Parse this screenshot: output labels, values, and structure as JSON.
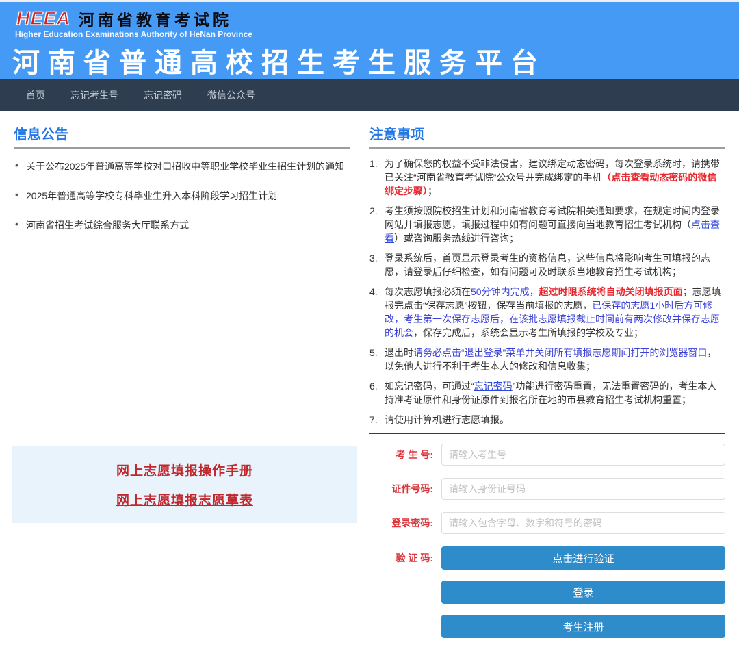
{
  "header": {
    "logo_acronym": "HEEA",
    "org_name_cn": "河南省教育考试院",
    "org_name_en": "Higher Education Examinations Authority of HeNan Province",
    "site_title": "河南省普通高校招生考生服务平台"
  },
  "nav": {
    "items": [
      {
        "label": "首页"
      },
      {
        "label": "忘记考生号"
      },
      {
        "label": "忘记密码"
      },
      {
        "label": "微信公众号"
      }
    ]
  },
  "bulletin": {
    "title": "信息公告",
    "items": [
      "关于公布2025年普通高等学校对口招收中等职业学校毕业生招生计划的通知",
      "2025年普通高等学校专科毕业生升入本科阶段学习招生计划",
      "河南省招生考试综合服务大厅联系方式"
    ]
  },
  "doc_links": [
    "网上志愿填报操作手册",
    "网上志愿填报志愿草表"
  ],
  "notices": {
    "title": "注意事项",
    "items": [
      [
        {
          "t": "为了确保您的权益不受非法侵害，建议绑定动态密码，每次登录系统时，请携带已关注“河南省教育考试院”公众号并完成绑定的手机",
          "s": "n"
        },
        {
          "t": "（点击查看动态密码的微信绑定步骤）",
          "s": "rl"
        },
        {
          "t": "；",
          "s": "n"
        }
      ],
      [
        {
          "t": "考生须按照院校招生计划和河南省教育考试院相关通知要求，在规定时间内登录网站并填报志愿，填报过程中如有问题可直接向当地教育招生考试机构（",
          "s": "n"
        },
        {
          "t": "点击查看",
          "s": "bl"
        },
        {
          "t": "）或咨询服务热线进行咨询；",
          "s": "n"
        }
      ],
      [
        {
          "t": "登录系统后，首页显示登录考生的资格信息，这些信息将影响考生可填报的志愿，请登录后仔细检查，如有问题可及时联系当地教育招生考试机构；",
          "s": "n"
        }
      ],
      [
        {
          "t": "每次志愿填报必须在",
          "s": "n"
        },
        {
          "t": "50分钟内完成，",
          "s": "b"
        },
        {
          "t": "超过时限系统将自动关闭填报页面",
          "s": "r"
        },
        {
          "t": "；志愿填报完点击“保存志愿”按钮，保存当前填报的志愿，",
          "s": "n"
        },
        {
          "t": "已保存的志愿1小时后方可修改，考生第一次保存志愿后，在该批志愿填报截止时间前有两次修改并保存志愿的机会",
          "s": "b"
        },
        {
          "t": "，保存完成后，系统会显示考生所填报的学校及专业；",
          "s": "n"
        }
      ],
      [
        {
          "t": "退出时",
          "s": "n"
        },
        {
          "t": "请务必点击“退出登录”菜单并关闭所有填报志愿期间打开的浏览器窗口",
          "s": "b"
        },
        {
          "t": "，以免他人进行不利于考生本人的修改和信息收集；",
          "s": "n"
        }
      ],
      [
        {
          "t": "如忘记密码，可通过“",
          "s": "n"
        },
        {
          "t": "忘记密码",
          "s": "bl"
        },
        {
          "t": "”功能进行密码重置，无法重置密码的，考生本人持准考证原件和身份证原件到报名所在地的市县教育招生考试机构重置；",
          "s": "n"
        }
      ],
      [
        {
          "t": "请使用计算机进行志愿填报。",
          "s": "n"
        }
      ]
    ]
  },
  "form": {
    "fields": [
      {
        "label": "考 生 号:",
        "placeholder": "请输入考生号"
      },
      {
        "label": "证件号码:",
        "placeholder": "请输入身份证号码"
      },
      {
        "label": "登录密码:",
        "placeholder": "请输入包含字母、数字和符号的密码"
      }
    ],
    "captcha_label": "验 证 码:",
    "captcha_button": "点击进行验证",
    "login_button": "登录",
    "register_button": "考生注册"
  },
  "colors": {
    "header_blue": "#459af6",
    "nav_dark": "#2f3d51",
    "section_heading_blue": "#2277e6",
    "notice_red": "#e8262d",
    "inline_blue": "#3a3fd8",
    "link_blue": "#2c46e0",
    "label_red": "#d9363c",
    "button_blue": "#2e8cca",
    "panel_light_blue": "#e9f3fb",
    "doc_link_red": "#c1272d"
  }
}
